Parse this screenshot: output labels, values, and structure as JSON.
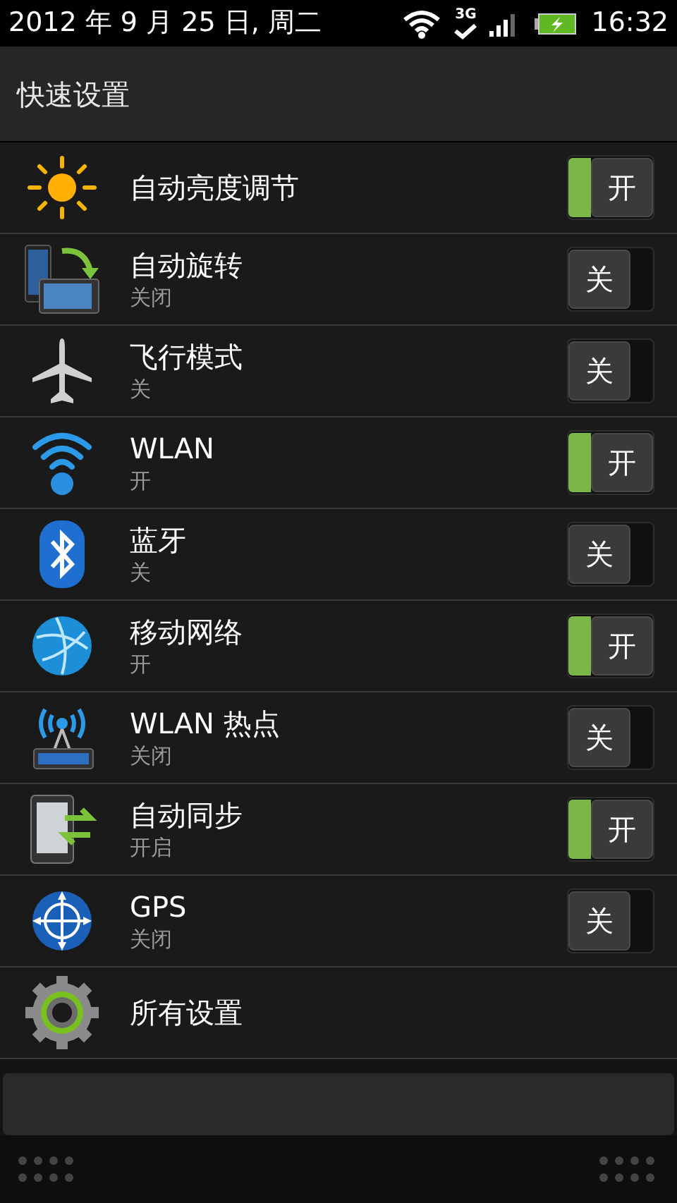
{
  "status_bar": {
    "date": "2012 年 9 月 25 日, 周二",
    "network": "3G",
    "time": "16:32"
  },
  "header": {
    "title": "快速设置"
  },
  "settings": [
    {
      "kind": "toggle",
      "title": "自动亮度调节",
      "on": true,
      "switch_label": "开"
    },
    {
      "kind": "toggle",
      "title": "自动旋转",
      "subtitle": "关闭",
      "on": false,
      "switch_label": "关"
    },
    {
      "kind": "toggle",
      "title": "飞行模式",
      "subtitle": "关",
      "on": false,
      "switch_label": "关"
    },
    {
      "kind": "toggle",
      "title": "WLAN",
      "subtitle": "开",
      "on": true,
      "switch_label": "开"
    },
    {
      "kind": "toggle",
      "title": "蓝牙",
      "subtitle": "关",
      "on": false,
      "switch_label": "关"
    },
    {
      "kind": "toggle",
      "title": "移动网络",
      "subtitle": "开",
      "on": true,
      "switch_label": "开"
    },
    {
      "kind": "toggle",
      "title": "WLAN 热点",
      "subtitle": "关闭",
      "on": false,
      "switch_label": "关"
    },
    {
      "kind": "toggle",
      "title": "自动同步",
      "subtitle": "开启",
      "on": true,
      "switch_label": "开"
    },
    {
      "kind": "toggle",
      "title": "GPS",
      "subtitle": "关闭",
      "on": false,
      "switch_label": "关"
    },
    {
      "kind": "link",
      "title": "所有设置"
    }
  ]
}
